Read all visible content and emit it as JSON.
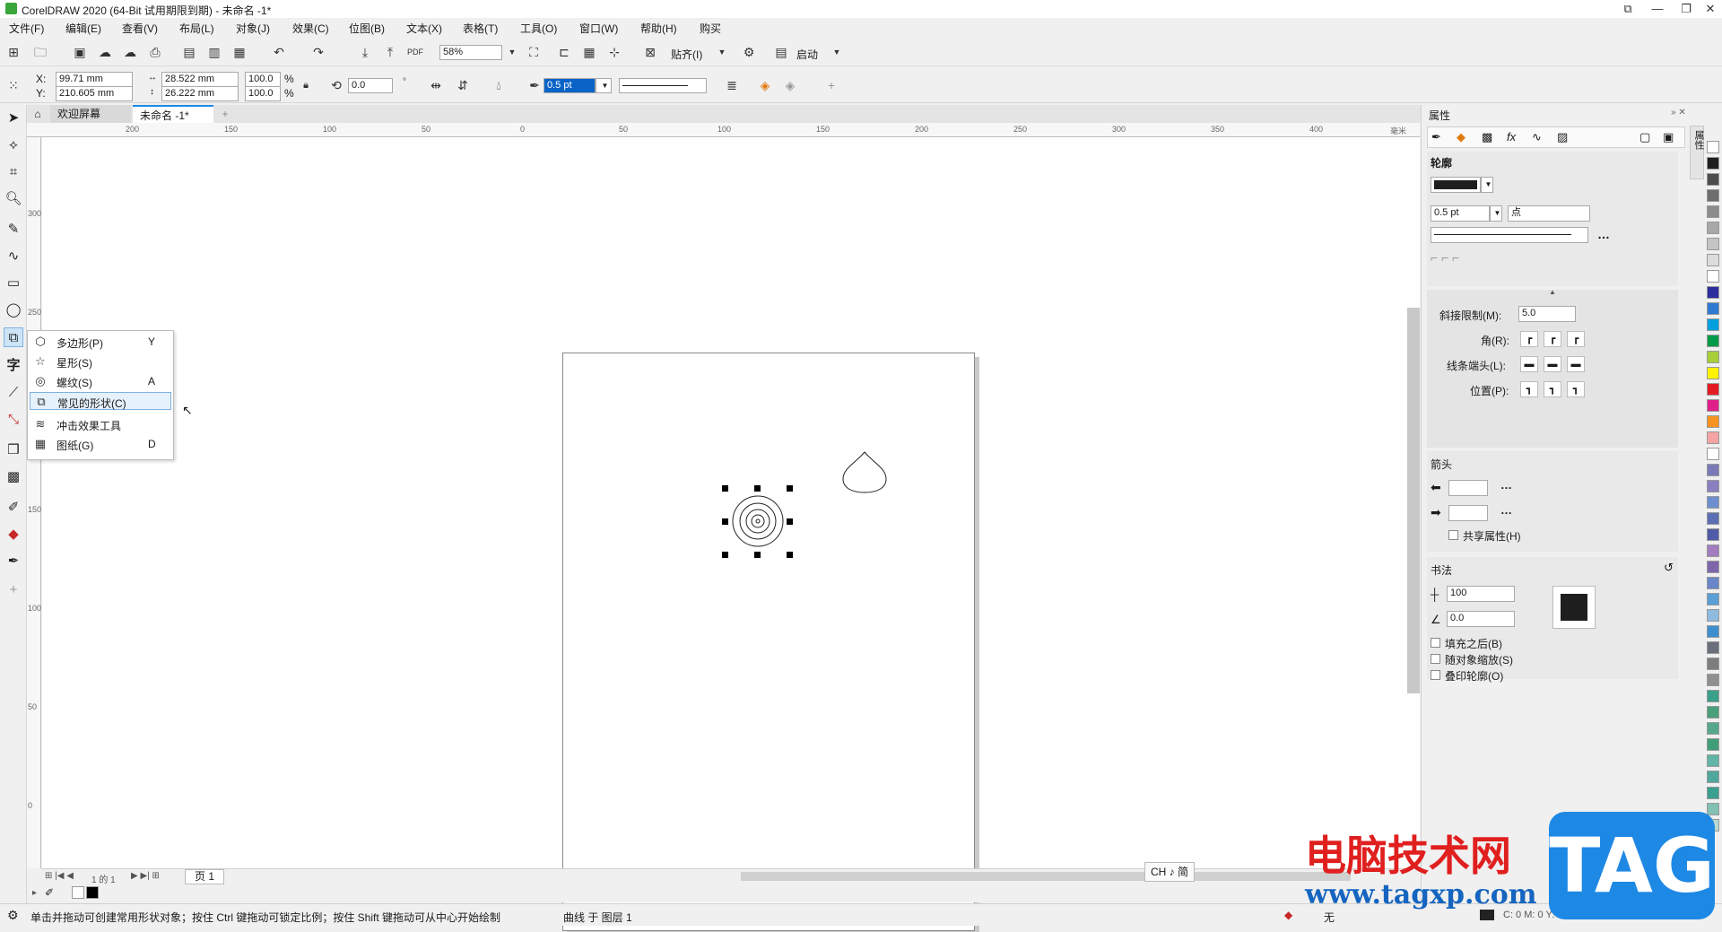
{
  "window": {
    "title": "CorelDRAW 2020 (64-Bit 试用期限到期) - 未命名 -1*",
    "controls": [
      "⧉",
      "—",
      "❐",
      "✕"
    ]
  },
  "menu": [
    "文件(F)",
    "编辑(E)",
    "查看(V)",
    "布局(L)",
    "对象(J)",
    "效果(C)",
    "位图(B)",
    "文本(X)",
    "表格(T)",
    "工具(O)",
    "窗口(W)",
    "帮助(H)",
    "购买"
  ],
  "toolbar": {
    "zoom": "58%",
    "snap_label": "贴齐(I)",
    "launch_label": "启动"
  },
  "property_bar": {
    "x_label": "X:",
    "x": "99.71 mm",
    "y_label": "Y:",
    "y": "210.605 mm",
    "w": "28.522 mm",
    "h": "26.222 mm",
    "scale_w": "100.0",
    "scale_h": "100.0",
    "percent": "%",
    "rotation": "0.0",
    "outline_width": "0.5 pt"
  },
  "tabs": {
    "welcome": "欢迎屏幕",
    "document": "未命名 -1*",
    "add": "+"
  },
  "ruler": {
    "h_ticks": [
      "200",
      "150",
      "100",
      "50",
      "0",
      "50",
      "100",
      "150",
      "200",
      "250",
      "300",
      "350",
      "400"
    ],
    "v_ticks": [
      "300",
      "250",
      "200",
      "150",
      "100",
      "50",
      "0"
    ],
    "unit": "毫米"
  },
  "flyout": [
    {
      "icon": "polygon-icon",
      "glyph": "⬡",
      "label": "多边形(P)",
      "key": "Y"
    },
    {
      "icon": "star-icon",
      "glyph": "☆",
      "label": "星形(S)",
      "key": ""
    },
    {
      "icon": "spiral-icon",
      "glyph": "◎",
      "label": "螺纹(S)",
      "key": "A"
    },
    {
      "icon": "common-shapes-icon",
      "glyph": "⧉",
      "label": "常见的形状(C)",
      "key": ""
    },
    {
      "icon": "impact-icon",
      "glyph": "≋",
      "label": "冲击效果工具",
      "key": ""
    },
    {
      "icon": "graph-paper-icon",
      "glyph": "▦",
      "label": "图纸(G)",
      "key": "D"
    }
  ],
  "page_nav": {
    "page_tab": "页 1",
    "counter": "1 的 1"
  },
  "ime": "CH ♪ 简",
  "status": {
    "hint": "单击并拖动可创建常用形状对象；按住 Ctrl 键拖动可锁定比例；按住 Shift 键拖动可从中心开始绘制",
    "object": "曲线 于 图层 1",
    "fill": "无",
    "color_readout": "C: 0 M: 0 Y: 0 K: 100"
  },
  "docker": {
    "title": "属性",
    "outline_header": "轮廓",
    "outline_width": "0.5 pt",
    "unit": "点",
    "miter_label": "斜接限制(M):",
    "miter_value": "5.0",
    "corner_label": "角(R):",
    "cap_label": "线条端头(L):",
    "position_label": "位置(P):",
    "arrows_header": "箭头",
    "share_label": "共享属性(H)",
    "calligraphy_header": "书法",
    "stretch": "100",
    "angle": "0.0",
    "fill_behind": "填充之后(B)",
    "scale_with": "随对象缩放(S)",
    "overprint": "叠印轮廓(O)",
    "side_tab": "属性"
  },
  "palette": [
    "#ffffff",
    "#1e1e1e",
    "#4d4d4d",
    "#6d6d6d",
    "#8c8c8c",
    "#a8a8a8",
    "#c4c4c4",
    "#dcdcdc",
    "#ffffff",
    "#2b2e9c",
    "#2e7bd1",
    "#00a0e0",
    "#009a48",
    "#a8cf3a",
    "#fff200",
    "#e31b23",
    "#e01f8a",
    "#f7931e",
    "#f5a3a3",
    "#ffffff",
    "#7a7ab8",
    "#8a7fc0",
    "#6e8fcf",
    "#5b6fb2",
    "#4f5ba8",
    "#a47cc0",
    "#7e66aa",
    "#6a86c8",
    "#5aa0d6",
    "#8fbbe0",
    "#3e8fcf",
    "#6b6f7b",
    "#7d7d7d",
    "#909090",
    "#3aa08a",
    "#4aa07a",
    "#56a88c",
    "#3f9e78",
    "#62b4a6",
    "#4fa89c",
    "#3b9f8f",
    "#82c0b4",
    "#b6d8d2"
  ],
  "watermark": {
    "text": "电脑技术网",
    "url": "www.tagxp.com",
    "tag": "TAG"
  }
}
